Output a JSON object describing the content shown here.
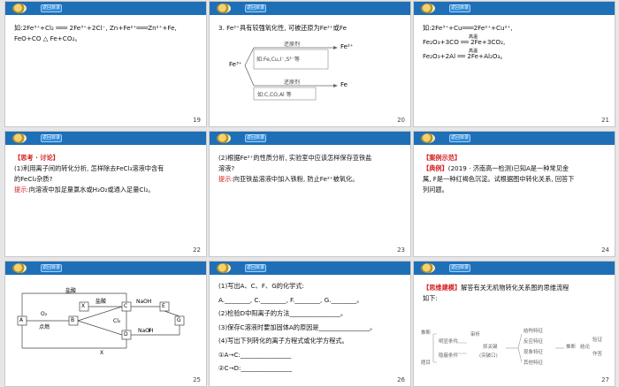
{
  "common": {
    "back_label": "返回目录"
  },
  "slides": [
    {
      "page": "19",
      "lines": [
        "如:2Fe³⁺+Cl₂ ═══ 2Fe³⁺+2Cl⁻, Zn+Fe²⁺═══Zn²⁺+Fe,",
        "FeO+CO △ Fe+CO₂。"
      ]
    },
    {
      "page": "20",
      "lines": [
        "3. Fe²⁺具有较强氧化性, 可被还原为Fe²⁺或Fe"
      ],
      "diagram": {
        "top_arrow": "还原剂",
        "top_cond": "如:Fe,Cu,I⁻,S²⁻等",
        "top_target": "Fe²⁺",
        "bottom_arrow": "还原剂",
        "bottom_cond": "如:C,CO,Al 等",
        "bottom_target": "Fe",
        "source": "Fe³⁺"
      }
    },
    {
      "page": "21",
      "lines": [
        "如:2Fe³⁺+Cu═══2Fe²⁺+Cu²⁺,",
        "Fe₂O₃+3CO ══ 2Fe+3CO₂,",
        "Fe₂O₃+2Al ══ 2Fe+Al₂O₃。"
      ],
      "over1": "高温",
      "over2": "高温"
    },
    {
      "page": "22",
      "heading": "【思考 · 讨论】",
      "lines": [
        "(1)利用离子间的转化分析, 怎样除去FeCl₃溶液中含有",
        "的FeCl₂杂质?"
      ],
      "hint_label": "提示:",
      "hint_text": "向溶液中加足量氯水或H₂O₂或通入足量Cl₂。"
    },
    {
      "page": "23",
      "lines": [
        "(2)根据Fe²⁺的性质分析, 实验室中应该怎样保存亚铁盐",
        "溶液?"
      ],
      "hint_label": "提示:",
      "hint_text": "向亚铁盐溶液中加入铁粉, 防止Fe²⁺被氧化。"
    },
    {
      "page": "24",
      "heading": "【案例示范】",
      "example_label": "【典例】",
      "lines": [
        "(2019 · 济南高一检测)已知A是一种常见金",
        "属, F是一种红褐色沉淀。试根据图中转化关系, 回答下",
        "列问题。"
      ]
    },
    {
      "page": "25",
      "labels": {
        "a": "A",
        "b": "B",
        "c": "C",
        "d": "D",
        "e": "E",
        "f": "F",
        "g": "G",
        "x": "X",
        "cl2": "Cl₂",
        "o2": "O₂",
        "burn": "点燃",
        "hcl1": "盐酸",
        "hcl2": "盐酸",
        "naoh1": "NaOH",
        "naoh2": "NaOH",
        "bottom_x": "X"
      }
    },
    {
      "page": "26",
      "lines": [
        "(1)写出A、C、F、G的化学式:",
        "A.________, C.________, F.________, G.________。",
        "(2)检验D中阳离子的方法________________。",
        "(3)保存C溶液时要加固体A的原因是________________。",
        "(4)写出下列转化的离子方程式或化学方程式。",
        "①A→C:________________",
        "②C→D:________________"
      ]
    },
    {
      "page": "27",
      "heading": "【思维建模】",
      "lines": [
        "解答有关无机物转化关系图的思维流程",
        "如下:"
      ],
      "flow": {
        "n1": "推断",
        "n2": "题目",
        "n3": "明显条件",
        "n4": "隐蔽条件",
        "n5": "审析",
        "n6": "抓关键",
        "n7": "(突破口)",
        "n8": "结构特征",
        "n9": "反应特征",
        "n10": "现象特征",
        "n11": "其他特征",
        "n12": "推断",
        "n13": "结论",
        "n14": "验证",
        "n15": "作答"
      }
    }
  ]
}
